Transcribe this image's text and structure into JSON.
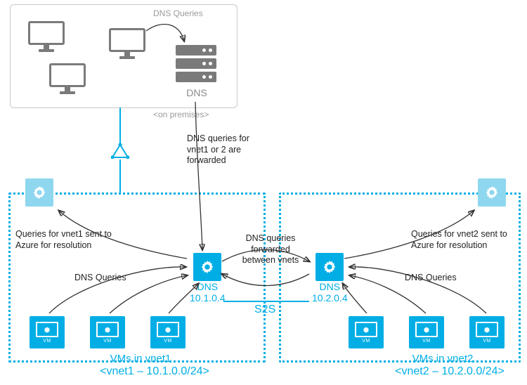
{
  "onprem": {
    "query_label": "DNS Queries",
    "server_label": "DNS",
    "caption": "<on premises>"
  },
  "labels": {
    "onprem_to_vnet": "DNS queries for vnet1 or 2 are forwarded",
    "between_vnets": "DNS queries forwarded between vnets",
    "s2s": "S2S",
    "vnet1_azure": "Queries for vnet1 sent to Azure for resolution",
    "vnet2_azure": "Queries for vnet2 sent to Azure for resolution",
    "vnet1_dnsq": "DNS Queries",
    "vnet2_dnsq": "DNS Queries"
  },
  "vnet1": {
    "dns_label": "DNS",
    "dns_ip": "10.1.0.4",
    "vms_label": "VMs in vnet1",
    "cidr": "<vnet1 – 10.1.0.0/24>"
  },
  "vnet2": {
    "dns_label": "DNS",
    "dns_ip": "10.2.0.4",
    "vms_label": "VMs in vnet2",
    "cidr": "<vnet2 – 10.2.0.0/24>"
  },
  "vm": {
    "label": "VM"
  }
}
